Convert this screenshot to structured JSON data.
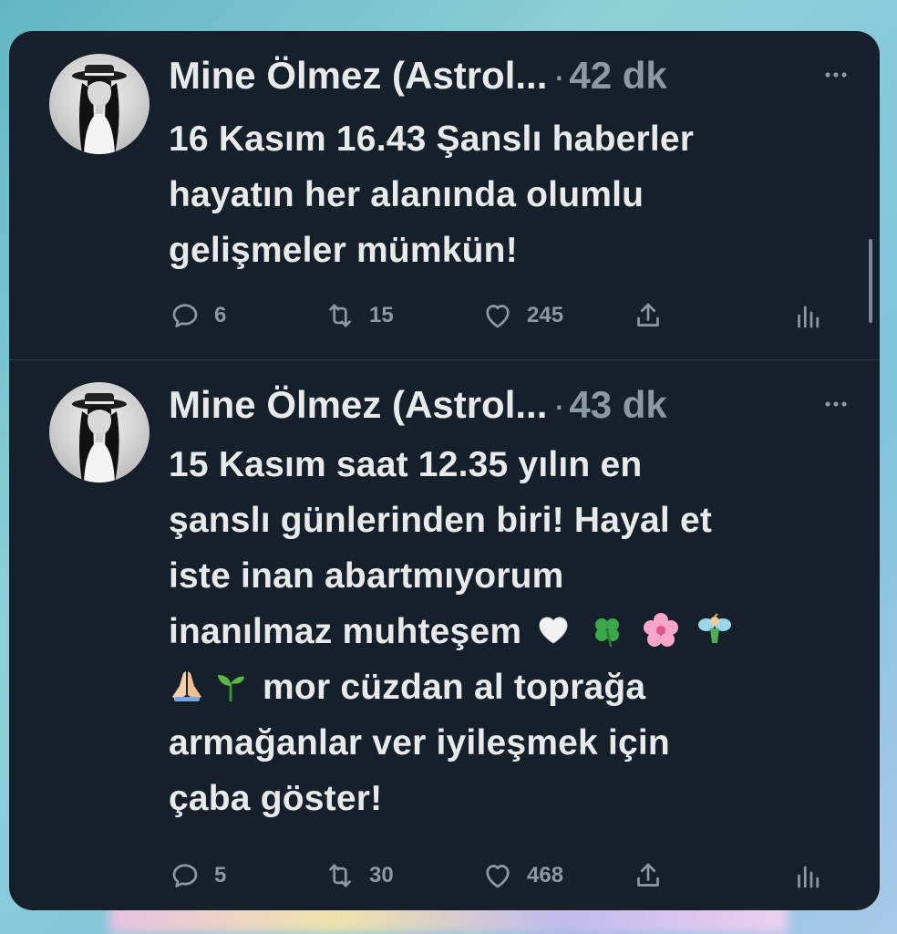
{
  "colors": {
    "panel_bg": "#15202b",
    "text_primary": "#e7e9ea",
    "text_secondary": "#8b98a5",
    "divider": "#2f3b47"
  },
  "tweets": [
    {
      "author": "Mine Ölmez (Astrol...",
      "separator": "·",
      "time": "42 dk",
      "more_icon": "more-horizontal-icon",
      "lines": [
        "16 Kasım 16.43 Şanslı haberler",
        "hayatın her alanında olumlu",
        "gelişmeler mümkün!"
      ],
      "replies": "6",
      "retweets": "15",
      "likes": "245"
    },
    {
      "author": "Mine Ölmez (Astrol...",
      "separator": "·",
      "time": "43 dk",
      "more_icon": "more-horizontal-icon",
      "lines": [
        "15 Kasım saat 12.35 yılın en",
        "şanslı günlerinden biri! Hayal et",
        "iste inan abartmıyorum",
        "inanılmaz muhteşem",
        "mor cüzdan al toprağa",
        "armağanlar ver iyileşmek için",
        "çaba göster!"
      ],
      "emojis_line4": [
        "white-heart-icon",
        "four-leaf-clover-icon",
        "cherry-blossom-icon",
        "fairy-icon"
      ],
      "emojis_line5": [
        "folded-hands-icon",
        "seedling-icon"
      ],
      "replies": "5",
      "retweets": "30",
      "likes": "468"
    }
  ]
}
